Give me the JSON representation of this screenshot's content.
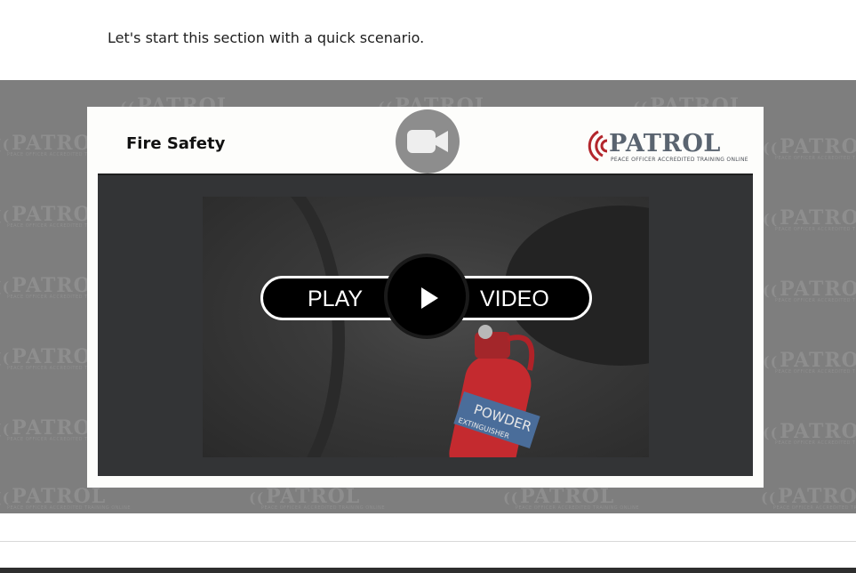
{
  "intro_text": "Let's start this section with a quick scenario.",
  "card": {
    "title": "Fire Safety",
    "brand_name": "PATROL",
    "brand_tagline": "PEACE OFFICER ACCREDITED TRAINING ONLINE"
  },
  "video": {
    "play_left": "PLAY",
    "play_right": "VIDEO",
    "extinguisher_label": "POWDER",
    "extinguisher_sublabel": "EXTINGUISHER"
  },
  "icons": {
    "camera": "video-camera-icon",
    "play": "play-icon",
    "brand_waves": "signal-waves-icon"
  },
  "colors": {
    "background_band": "#7e7e7e",
    "brand_red": "#b3262c",
    "brand_gray": "#5a6470"
  }
}
